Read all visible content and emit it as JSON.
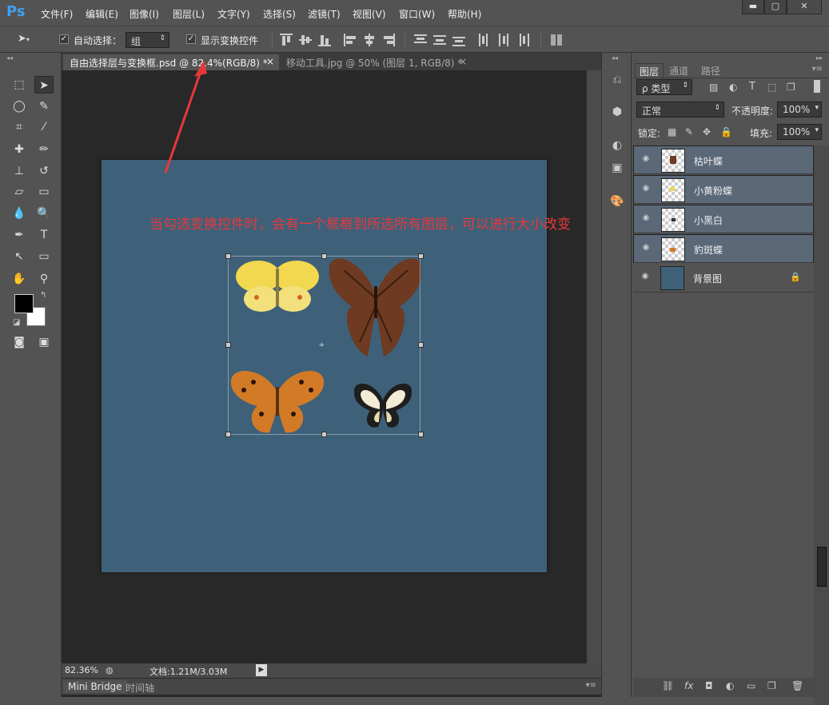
{
  "app": {
    "logo": "Ps"
  },
  "menu": [
    "文件(F)",
    "编辑(E)",
    "图像(I)",
    "图层(L)",
    "文字(Y)",
    "选择(S)",
    "滤镜(T)",
    "视图(V)",
    "窗口(W)",
    "帮助(H)"
  ],
  "window_controls": {
    "minimize": "▬",
    "maximize": "▢",
    "close": "✕"
  },
  "options": {
    "auto_select_label": "自动选择：",
    "auto_select_value": "组",
    "show_transform_label": "显示变换控件"
  },
  "tabs": [
    {
      "title": "自由选择层与变换框.psd @ 82.4%(RGB/8) *",
      "close": "×"
    },
    {
      "title": "移动工具.jpg @ 50% (图层 1, RGB/8) *",
      "close": "×"
    }
  ],
  "annotation": {
    "text": "当勾选变换控件时，会有一个框框到所选所有图层，可以进行大小改变",
    "color": "#e8373c"
  },
  "status": {
    "zoom": "82.36%",
    "doc_info": "文档:1.21M/3.03M"
  },
  "bottom_tabs": [
    "Mini Bridge",
    "时间轴"
  ],
  "layers_panel": {
    "tabs": [
      "图层",
      "通道",
      "路径"
    ],
    "filter_label": "ρ 类型",
    "blend_mode": "正常",
    "opacity_label": "不透明度:",
    "opacity_value": "100%",
    "lock_label": "锁定:",
    "fill_label": "填充:",
    "fill_value": "100%",
    "layers": [
      {
        "name": "枯叶蝶",
        "selected": true
      },
      {
        "name": "小黄粉蝶",
        "selected": true
      },
      {
        "name": "小黑白",
        "selected": true
      },
      {
        "name": "豹斑蝶",
        "selected": true
      },
      {
        "name": "背景图",
        "selected": false,
        "locked": true
      }
    ]
  },
  "colors": {
    "canvas_bg": "#3e6179",
    "selection_row": "#5a6878",
    "accent": "#3fa0f0"
  }
}
